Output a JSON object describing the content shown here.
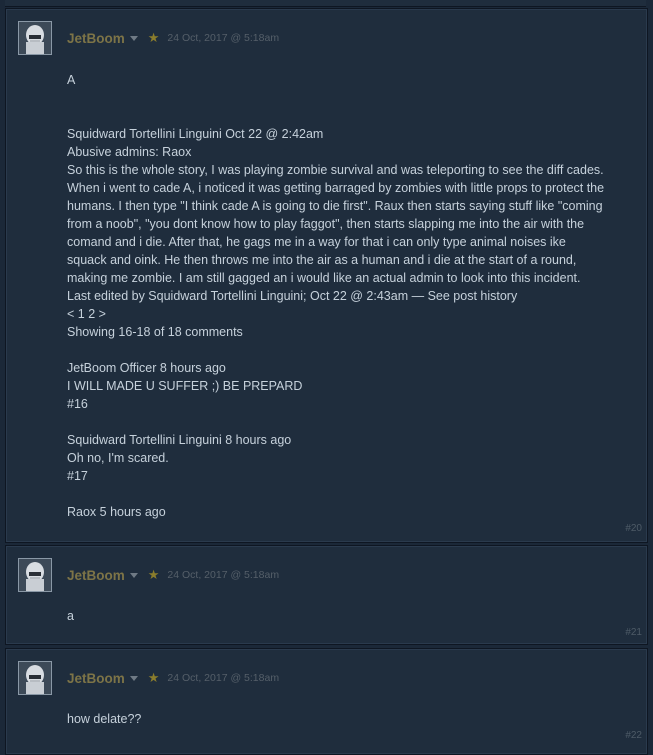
{
  "posts": [
    {
      "author": "JetBoom",
      "date": "24 Oct, 2017 @ 5:18am",
      "number": "#20",
      "lines": [
        "A",
        "",
        "",
        "Squidward Tortellini Linguini Oct 22 @ 2:42am",
        "Abusive admins: Raox",
        "So this is the whole story, I was playing zombie survival and was teleporting to see the diff cades.",
        "When i went to cade A, i noticed it was getting barraged by zombies with little props to protect the",
        "humans. I then type \"I think cade A is going to die first\". Raux then starts saying stuff like \"coming",
        "from a noob\", \"you dont know how to play faggot\", then starts slapping me into the air with the",
        "comand and i die. After that, he gags me in a way for that i can only type animal noises ike",
        "squack and oink. He then throws me into the air as a human and i die at the start of a round,",
        "making me zombie. I am still gagged an i would like an actual admin to look into this incident.",
        "Last edited by Squidward Tortellini Linguini; Oct 22 @ 2:43am — See post history",
        "< 1 2 >",
        "Showing 16-18 of 18 comments",
        "",
        "JetBoom Officer 8 hours ago",
        "I WILL MADE U SUFFER ;) BE PREPARD",
        "#16",
        "",
        "Squidward Tortellini Linguini 8 hours ago",
        "Oh no, I'm scared.",
        "#17",
        "",
        "Raox 5 hours ago"
      ]
    },
    {
      "author": "JetBoom",
      "date": "24 Oct, 2017 @ 5:18am",
      "number": "#21",
      "lines": [
        "a"
      ]
    },
    {
      "author": "JetBoom",
      "date": "24 Oct, 2017 @ 5:18am",
      "number": "#22",
      "lines": [
        "how delate??"
      ]
    }
  ],
  "icons": {
    "favorite": "star-icon",
    "menu": "chevron-down-icon",
    "avatar": "avatar-portrait"
  },
  "colors": {
    "background": "#1b2838",
    "panel": "#1f2d3d",
    "author": "#7d7447",
    "star": "#8b7d2c",
    "text": "#c6d1db",
    "muted": "#555f69"
  }
}
